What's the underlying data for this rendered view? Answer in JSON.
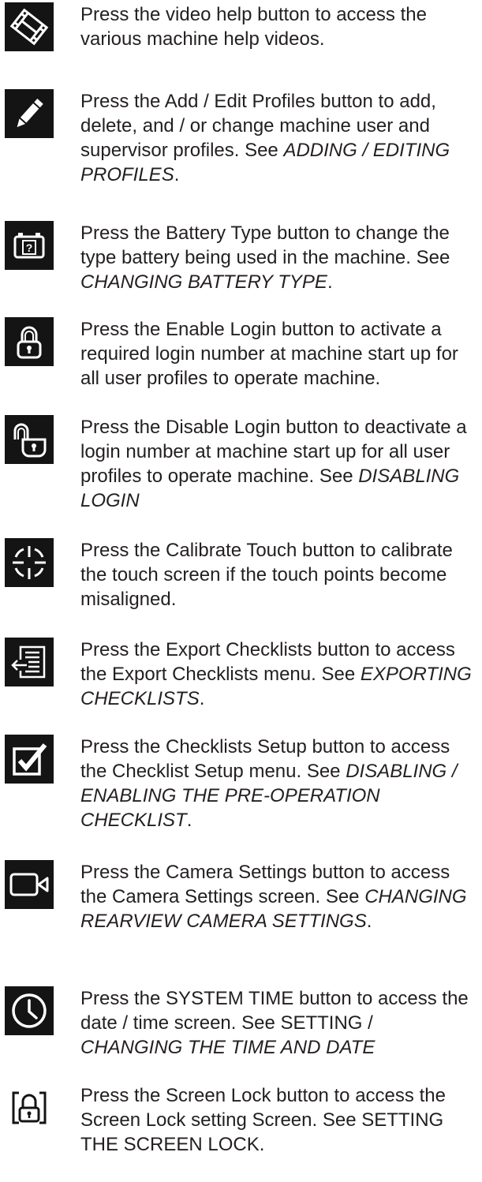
{
  "entries": [
    {
      "icon": "film-icon",
      "text": "Press the video help button to access the various machine help videos.",
      "ref": "",
      "tail": ""
    },
    {
      "icon": "pencil-icon",
      "text": "Press the Add / Edit Profiles button to add, delete, and / or change machine user and supervisor profiles. See ",
      "ref": "ADDING / EDITING PROFILES",
      "tail": "."
    },
    {
      "icon": "battery-question-icon",
      "text": "Press the Battery Type button to change the type battery being used in the machine. See ",
      "ref": "CHANGING BATTERY TYPE",
      "tail": "."
    },
    {
      "icon": "lock-closed-icon",
      "text": "Press the Enable Login button to activate a required login number at machine start up for all user profiles to operate machine.",
      "ref": "",
      "tail": ""
    },
    {
      "icon": "lock-open-icon",
      "text": "Press the Disable Login button to deactivate a login number at machine start up for all user profiles to operate machine. See ",
      "ref": "DISABLING LOGIN",
      "tail": ""
    },
    {
      "icon": "crosshair-icon",
      "text": "Press the Calibrate Touch button to calibrate the touch screen if the touch points become misaligned.",
      "ref": "",
      "tail": ""
    },
    {
      "icon": "export-list-icon",
      "text": "Press the Export Checklists button to access the Export Checklists menu. See ",
      "ref": "EXPORTING CHECKLISTS",
      "tail": "."
    },
    {
      "icon": "checkbox-icon",
      "text": "Press the Checklists Setup button to access the Checklist Setup menu. See ",
      "ref": "DISABLING / ENABLING THE PRE-OPERATION CHECKLIST",
      "tail": "."
    },
    {
      "icon": "camera-icon",
      "text": "Press the Camera Settings button to access the Camera Settings screen. See ",
      "ref": "CHANGING REARVIEW CAMERA SETTINGS",
      "tail": "."
    },
    {
      "icon": "clock-icon",
      "text": "Press the SYSTEM TIME button to access the date / time screen. See SETTING / ",
      "ref": "CHANGING THE TIME AND DATE",
      "tail": ""
    },
    {
      "icon": "screen-lock-icon",
      "text": "Press the Screen Lock button to access the Screen Lock setting Screen. See SETTING THE SCREEN LOCK.",
      "ref": "",
      "tail": ""
    }
  ]
}
